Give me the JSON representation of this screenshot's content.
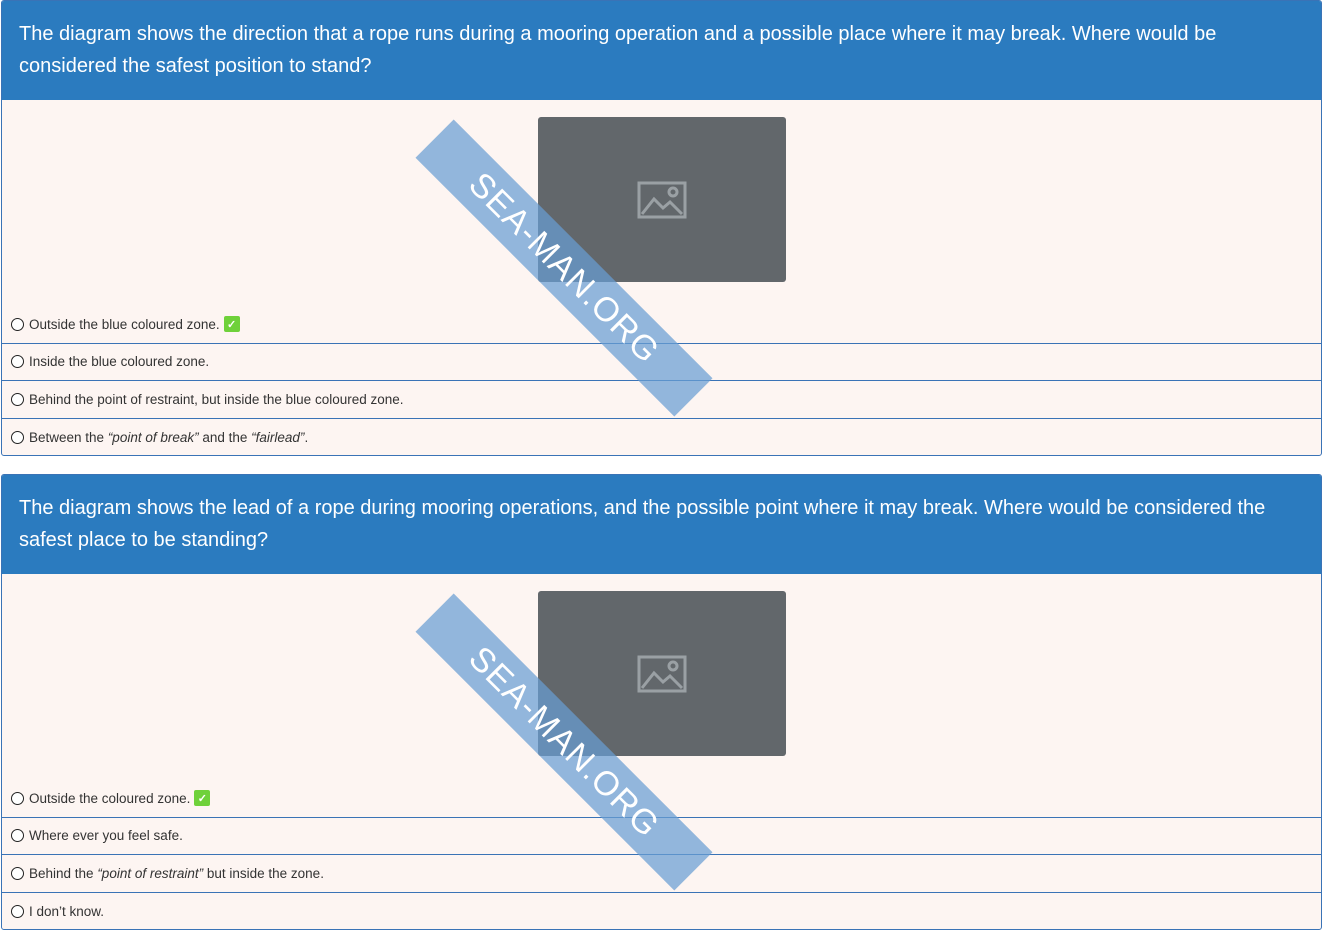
{
  "watermark": "SEA-MAN.ORG",
  "colors": {
    "header_bg": "#2b7bbf",
    "card_bg": "#fdf5f2",
    "border": "#3a73b6",
    "correct_badge": "#6fd13a",
    "image_placeholder": "#62676b",
    "watermark": "#689ed2"
  },
  "questions": [
    {
      "text": "The diagram shows the direction that a rope runs during a mooring operation and a possible place where it may break. Where would be considered the safest position to stand?",
      "image_icon": "image-icon",
      "answers": [
        {
          "parts": [
            "Outside the blue coloured zone."
          ],
          "correct": true
        },
        {
          "parts": [
            "Inside the blue coloured zone."
          ],
          "correct": false
        },
        {
          "parts": [
            "Behind the point of restraint, but inside the blue coloured zone."
          ],
          "correct": false
        },
        {
          "parts": [
            "Between the ",
            "“point of break”",
            " and the ",
            "“fairlead”",
            "."
          ],
          "correct": false
        }
      ]
    },
    {
      "text": "The diagram shows the lead of a rope during mooring operations, and the possible point where it may break. Where would be considered the safest place to be standing?",
      "image_icon": "image-icon",
      "answers": [
        {
          "parts": [
            "Outside the coloured zone."
          ],
          "correct": true
        },
        {
          "parts": [
            "Where ever you feel safe."
          ],
          "correct": false
        },
        {
          "parts": [
            "Behind the ",
            "“point of restraint”",
            " but inside the zone."
          ],
          "correct": false
        },
        {
          "parts": [
            "I don’t know."
          ],
          "correct": false
        }
      ]
    }
  ]
}
